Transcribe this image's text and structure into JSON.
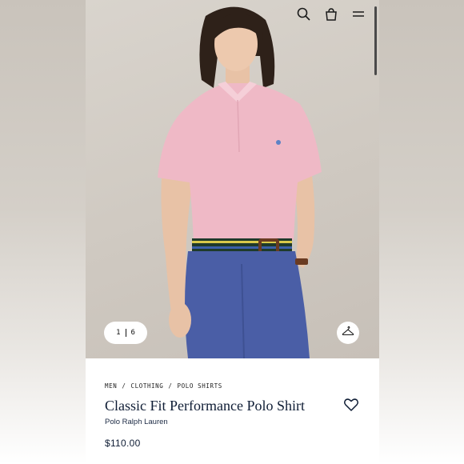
{
  "header": {
    "icons": [
      "search-icon",
      "shopping-bag-icon",
      "menu-icon"
    ]
  },
  "gallery": {
    "current": "1",
    "total": "6",
    "hanger_icon": "hanger-icon"
  },
  "breadcrumb": {
    "items": [
      "MEN",
      "CLOTHING",
      "POLO SHIRTS"
    ],
    "separator": "/"
  },
  "product": {
    "title": "Classic Fit Performance Polo Shirt",
    "brand": "Polo Ralph Lauren",
    "price": "$110.00",
    "favorite_icon": "heart-outline-icon"
  },
  "colors": {
    "navy": "#0f1d35",
    "shirt_pink": "#efb9c6",
    "pants_blue": "#4a5ea6",
    "backdrop": "#cfc9c1"
  }
}
